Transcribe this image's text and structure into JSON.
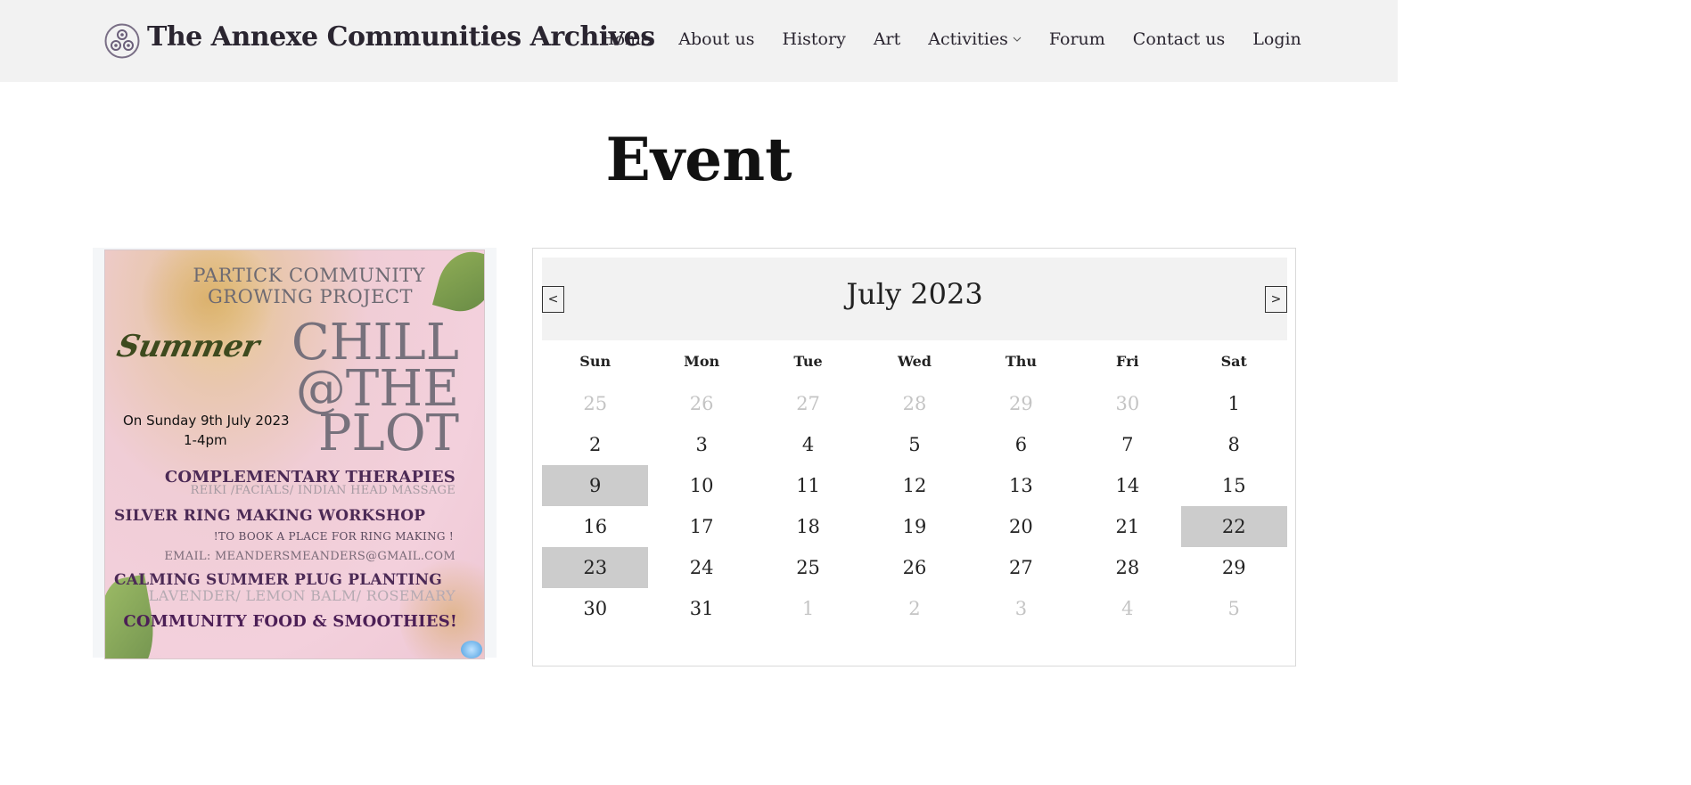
{
  "header": {
    "site_title": "The Annexe Communities Archives",
    "logo_icon": "triskele-icon",
    "nav": [
      {
        "label": "Home"
      },
      {
        "label": "About us"
      },
      {
        "label": "History"
      },
      {
        "label": "Art"
      },
      {
        "label": "Activities",
        "icon": "chevron-down-icon"
      },
      {
        "label": "Forum"
      },
      {
        "label": "Contact us"
      },
      {
        "label": "Login"
      }
    ]
  },
  "page": {
    "title": "Event"
  },
  "poster": {
    "org_line1": "PARTICK COMMUNITY",
    "org_line2": "GROWING PROJECT",
    "summer": "Summer",
    "big1": "CHILL",
    "big2": "@THE",
    "big3": "PLOT",
    "date": "On Sunday 9th July 2023",
    "time": "1-4pm",
    "therapies": "COMPLEMENTARY THERAPIES",
    "therapies_sub": "REIKI /FACIALS/ INDIAN HEAD MASSAGE",
    "workshop": "SILVER RING MAKING WORKSHOP",
    "book": "!TO BOOK A PLACE FOR RING MAKING !",
    "email": "EMAIL: MEANDERSMEANDERS@GMAIL.COM",
    "planting": "CALMING SUMMER PLUG PLANTING",
    "planting_sub": "LAVENDER/ LEMON BALM/ ROSEMARY",
    "food": "COMMUNITY FOOD & SMOOTHIES!"
  },
  "calendar": {
    "month_label": "July 2023",
    "prev_label": "<",
    "next_label": ">",
    "weekdays": [
      "Sun",
      "Mon",
      "Tue",
      "Wed",
      "Thu",
      "Fri",
      "Sat"
    ],
    "weeks": [
      [
        {
          "d": "25",
          "m": true
        },
        {
          "d": "26",
          "m": true
        },
        {
          "d": "27",
          "m": true
        },
        {
          "d": "28",
          "m": true
        },
        {
          "d": "29",
          "m": true
        },
        {
          "d": "30",
          "m": true
        },
        {
          "d": "1"
        }
      ],
      [
        {
          "d": "2"
        },
        {
          "d": "3"
        },
        {
          "d": "4"
        },
        {
          "d": "5"
        },
        {
          "d": "6"
        },
        {
          "d": "7"
        },
        {
          "d": "8"
        }
      ],
      [
        {
          "d": "9",
          "e": true
        },
        {
          "d": "10"
        },
        {
          "d": "11"
        },
        {
          "d": "12"
        },
        {
          "d": "13"
        },
        {
          "d": "14"
        },
        {
          "d": "15"
        }
      ],
      [
        {
          "d": "16"
        },
        {
          "d": "17"
        },
        {
          "d": "18"
        },
        {
          "d": "19"
        },
        {
          "d": "20"
        },
        {
          "d": "21"
        },
        {
          "d": "22",
          "e": true
        }
      ],
      [
        {
          "d": "23",
          "e": true
        },
        {
          "d": "24"
        },
        {
          "d": "25"
        },
        {
          "d": "26"
        },
        {
          "d": "27"
        },
        {
          "d": "28"
        },
        {
          "d": "29"
        }
      ],
      [
        {
          "d": "30"
        },
        {
          "d": "31"
        },
        {
          "d": "1",
          "m": true
        },
        {
          "d": "2",
          "m": true
        },
        {
          "d": "3",
          "m": true
        },
        {
          "d": "4",
          "m": true
        },
        {
          "d": "5",
          "m": true
        }
      ]
    ]
  }
}
